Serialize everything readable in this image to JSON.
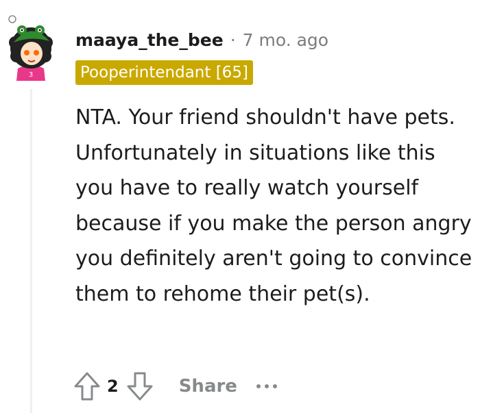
{
  "comment": {
    "username": "maaya_the_bee",
    "separator": "·",
    "time": "7 mo. ago",
    "flair": "Pooperintendant [65]",
    "body": "NTA. Your friend shouldn't have pets. Unfortunately in situations like this you have to really watch yourself because if you make the person angry you definitely aren't going to convince them to rehome their pet(s).",
    "score": "2",
    "share_label": "Share",
    "colors": {
      "flair_bg": "#c9a900",
      "muted": "#7c7c7c",
      "action_gray": "#878a8c",
      "thread_line": "#edeff1",
      "avatar_bg": "#222222",
      "avatar_hat": "#2e8b2e",
      "avatar_shirt": "#e8388a"
    },
    "icons": {
      "avatar": "user-avatar",
      "upvote": "arrow-up-icon",
      "downvote": "arrow-down-icon",
      "more": "ellipsis-icon"
    }
  }
}
